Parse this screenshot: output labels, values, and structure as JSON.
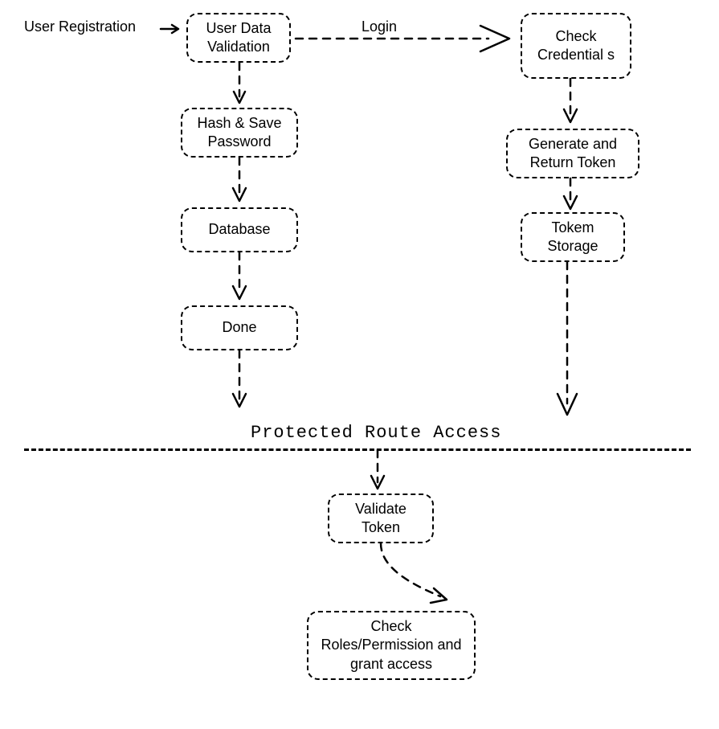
{
  "labels": {
    "user_registration": "User Registration",
    "login": "Login"
  },
  "nodes": {
    "user_data_validation": "User Data\nValidation",
    "hash_save_password": "Hash & Save\nPassword",
    "database": "Database",
    "done": "Done",
    "check_credentials": "Check\nCredential\ns",
    "generate_return_token": "Generate and\nReturn Token",
    "token_storage": "Tokem\nStorage",
    "validate_token": "Validate\nToken",
    "check_roles": "Check\nRoles/Permission\nand grant access"
  },
  "section": {
    "protected_route_access": "Protected Route Access"
  }
}
